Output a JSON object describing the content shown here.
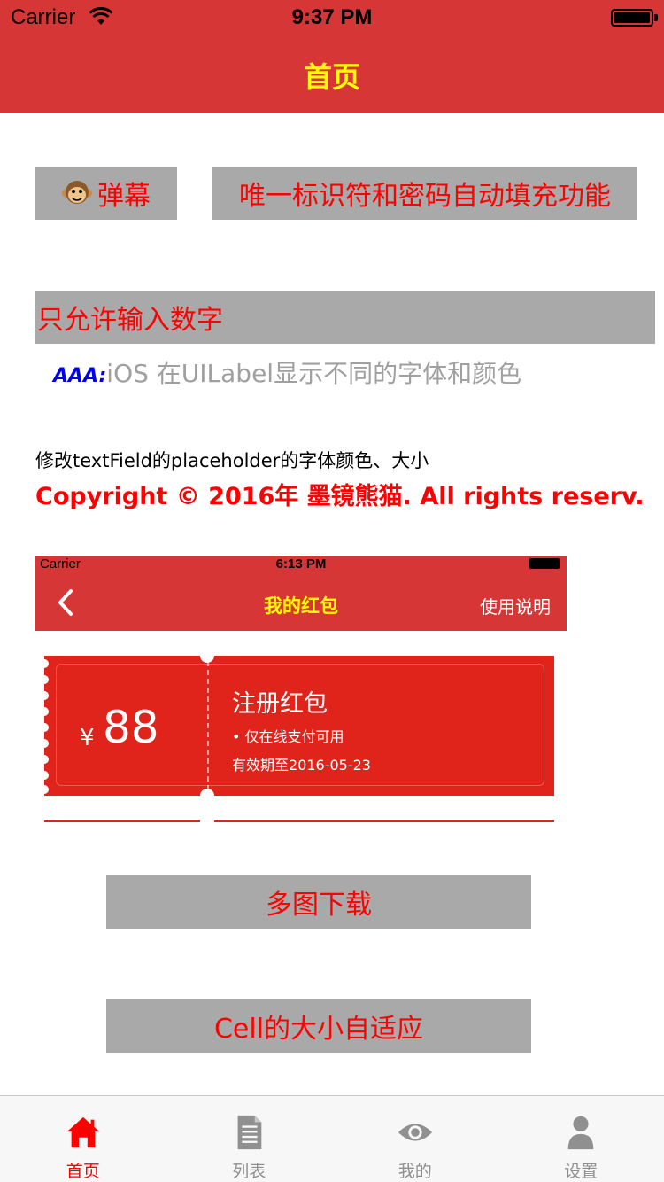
{
  "status_bar": {
    "carrier": "Carrier",
    "time": "9:37 PM"
  },
  "nav": {
    "title": "首页"
  },
  "buttons": {
    "danmu": "弹幕",
    "autofill": "唯一标识符和密码自动填充功能",
    "numbers_only": "只允许输入数字",
    "multi_download": "多图下载",
    "cell_adaptive": "Cell的大小自适应"
  },
  "attributed_label": {
    "prefix": "AAA:",
    "text": "iOS 在UILabel显示不同的字体和颜色"
  },
  "placeholder_label": "修改textField的placeholder的字体颜色、大小",
  "copyright_label": "Copyright © 2016年 墨镜熊猫. All rights reserv...",
  "embedded_screenshot": {
    "carrier": "Carrier",
    "time": "6:13 PM",
    "title": "我的红包",
    "right_action": "使用说明",
    "coupon": {
      "currency": "¥",
      "amount": "88",
      "name": "注册红包",
      "rule1": "• 仅在线支付可用",
      "rule2": "有效期至2016-05-23"
    }
  },
  "tabbar": {
    "items": [
      {
        "label": "首页",
        "icon": "home-icon",
        "active": true
      },
      {
        "label": "列表",
        "icon": "document-icon",
        "active": false
      },
      {
        "label": "我的",
        "icon": "eye-icon",
        "active": false
      },
      {
        "label": "设置",
        "icon": "person-icon",
        "active": false
      }
    ]
  },
  "colors": {
    "nav_background": "#d63636",
    "nav_title": "#ffff00",
    "button_background": "#a9a9a9",
    "button_text": "#ff0000",
    "tab_active": "#ff0000",
    "tab_inactive": "#909090",
    "coupon_red": "#e0241c"
  }
}
